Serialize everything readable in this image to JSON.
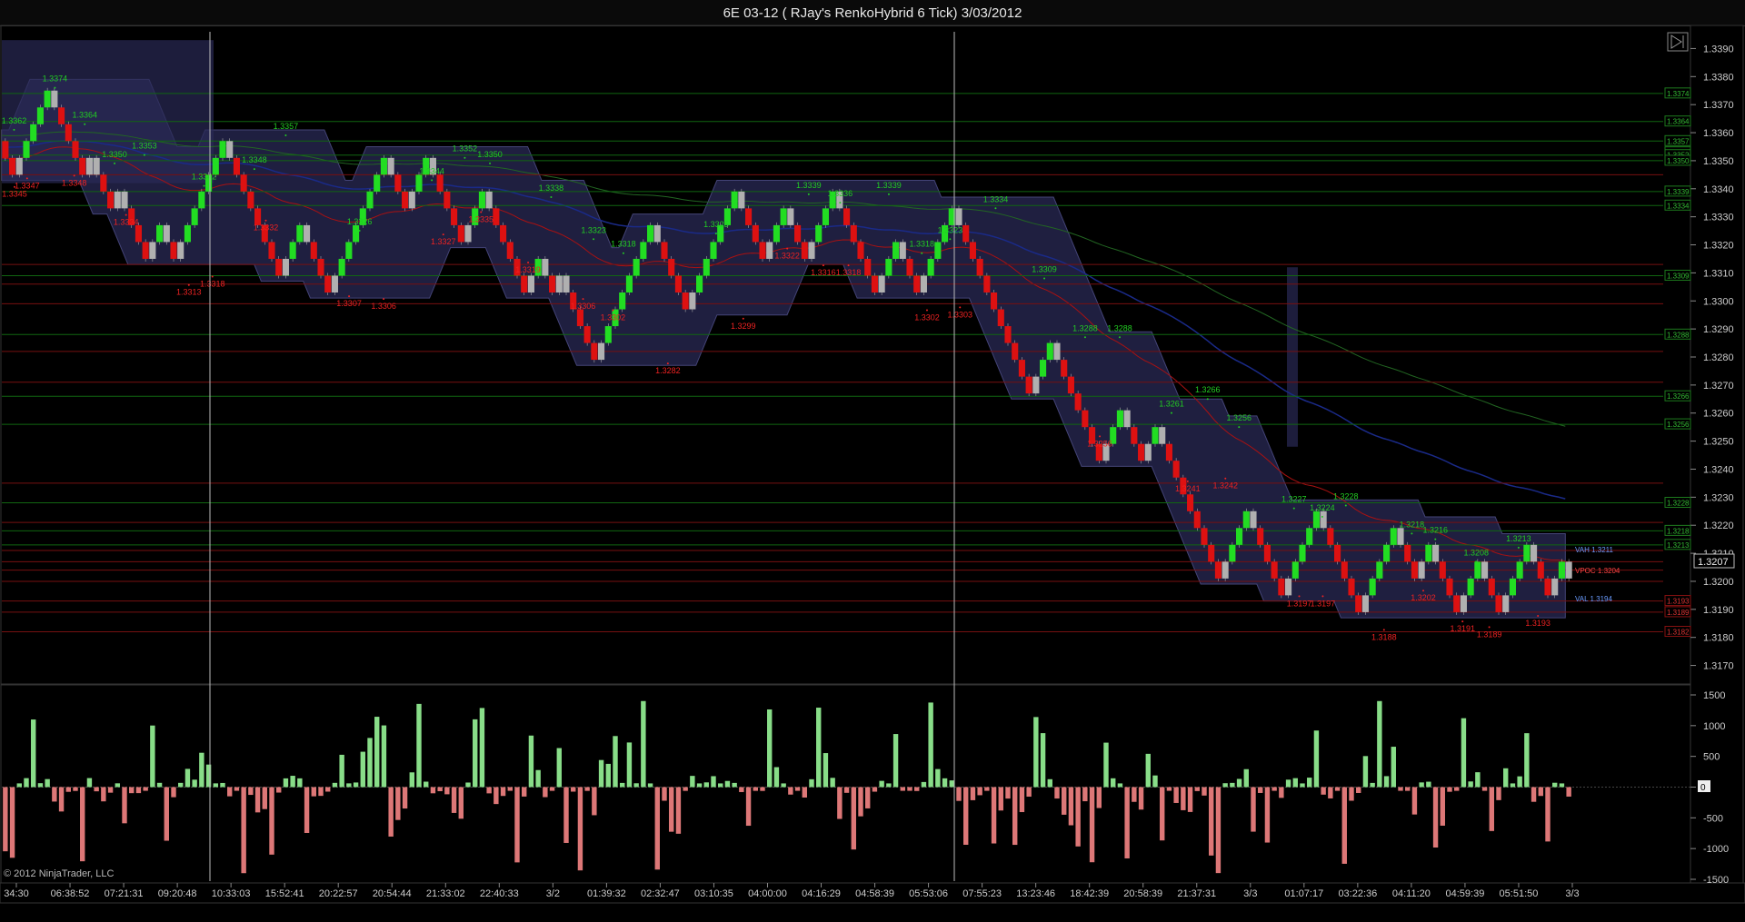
{
  "window": {
    "title": "6E 03-12 ( RJay's RenkoHybrid  6 Tick)  3/03/2012"
  },
  "copyright": "© 2012 NinjaTrader, LLC",
  "last_price": "1.3207",
  "colors": {
    "up_brick": "#22dd22",
    "down_brick": "#dd1111",
    "neutral_brick": "#b0b0b0",
    "band_fill": "#2a2a55",
    "swing_high": "#22cc22",
    "swing_low": "#ee2222",
    "volume_up": "#88dd88",
    "volume_down": "#dd7777",
    "va_label": "#6a9cff"
  },
  "value_area": {
    "vah": "VAH 1.3211",
    "vpoc": "VPOC 1.3204",
    "val": "VAL 1.3194"
  },
  "right_tags_green": [
    "1.3374",
    "1.3364",
    "1.3357",
    "1.3353",
    "1.3352",
    "1.3350",
    "1.3339",
    "1.3334",
    "1.3309",
    "1.3288",
    "1.3266",
    "1.3256",
    "1.3228",
    "1.3218",
    "1.3213"
  ],
  "right_tags_red": [
    "1.3193",
    "1.3189",
    "1.3182"
  ],
  "chart_data": [
    {
      "type": "line",
      "title": "6E 03-12 ( RJay's RenkoHybrid  6 Tick)  3/03/2012",
      "ylim": [
        1.3165,
        1.3395
      ],
      "y_ticks": [
        "1.3390",
        "1.3380",
        "1.3370",
        "1.3360",
        "1.3350",
        "1.3340",
        "1.3330",
        "1.3320",
        "1.3310",
        "1.3300",
        "1.3290",
        "1.3280",
        "1.3270",
        "1.3260",
        "1.3250",
        "1.3240",
        "1.3230",
        "1.3220",
        "1.3210",
        "1.3200",
        "1.3190",
        "1.3180",
        "1.3170"
      ],
      "x_ticks": [
        "34:30",
        "06:38:52",
        "07:21:31",
        "09:20:48",
        "10:33:03",
        "15:52:41",
        "20:22:57",
        "20:54:44",
        "21:33:02",
        "22:40:33",
        "3/2",
        "01:39:32",
        "02:32:47",
        "03:10:35",
        "04:00:00",
        "04:16:29",
        "04:58:39",
        "05:53:06",
        "07:55:23",
        "13:23:46",
        "18:42:39",
        "20:58:39",
        "21:37:31",
        "3/3",
        "01:07:17",
        "03:22:36",
        "04:11:20",
        "04:59:39",
        "05:51:50",
        "3/3"
      ],
      "price_path": [
        1.3357,
        1.3347,
        1.3374,
        1.3348,
        1.3353,
        1.3334,
        1.3341,
        1.3313,
        1.333,
        1.3318,
        1.3348,
        1.3357,
        1.3342,
        1.3307,
        1.3326,
        1.3306,
        1.3344,
        1.3352,
        1.3335,
        1.335,
        1.3319,
        1.3338,
        1.3306,
        1.3318,
        1.3302,
        1.3312,
        1.3282,
        1.3325,
        1.3299,
        1.3322,
        1.3339,
        1.3316,
        1.3336,
        1.3318,
        1.3339,
        1.3302,
        1.3323,
        1.3303,
        1.3334,
        1.3309,
        1.3288,
        1.3266,
        1.3288,
        1.3256,
        1.3241,
        1.3261,
        1.3242,
        1.3256,
        1.32,
        1.3227,
        1.3197,
        1.3228,
        1.3188,
        1.3218,
        1.3202,
        1.3216,
        1.3191,
        1.3208,
        1.3189,
        1.3213,
        1.3193,
        1.321,
        1.3204
      ],
      "swing_high_labels": [
        {
          "text": "1.3362",
          "x": 0.002,
          "price": 1.3362
        },
        {
          "text": "1.3374",
          "x": 0.028,
          "price": 1.3377
        },
        {
          "text": "1.3364",
          "x": 0.047,
          "price": 1.3364
        },
        {
          "text": "1.3350",
          "x": 0.066,
          "price": 1.335
        },
        {
          "text": "1.3353",
          "x": 0.085,
          "price": 1.3353
        },
        {
          "text": "1.3342",
          "x": 0.123,
          "price": 1.3342
        },
        {
          "text": "1.3348",
          "x": 0.155,
          "price": 1.3348
        },
        {
          "text": "1.3357",
          "x": 0.175,
          "price": 1.336
        },
        {
          "text": "1.3344",
          "x": 0.268,
          "price": 1.3344
        },
        {
          "text": "1.3352",
          "x": 0.289,
          "price": 1.3352
        },
        {
          "text": "1.3350",
          "x": 0.305,
          "price": 1.335
        },
        {
          "text": "1.3338",
          "x": 0.344,
          "price": 1.3338
        },
        {
          "text": "1.3326",
          "x": 0.222,
          "price": 1.3326
        },
        {
          "text": "1.3323",
          "x": 0.371,
          "price": 1.3323
        },
        {
          "text": "1.3318",
          "x": 0.39,
          "price": 1.3318
        },
        {
          "text": "1.3325",
          "x": 0.449,
          "price": 1.3325
        },
        {
          "text": "1.3339",
          "x": 0.508,
          "price": 1.3339
        },
        {
          "text": "1.3336",
          "x": 0.528,
          "price": 1.3336
        },
        {
          "text": "1.3339",
          "x": 0.559,
          "price": 1.3339
        },
        {
          "text": "1.3318",
          "x": 0.58,
          "price": 1.3318
        },
        {
          "text": "1.3323",
          "x": 0.598,
          "price": 1.3323
        },
        {
          "text": "1.3334",
          "x": 0.627,
          "price": 1.3334
        },
        {
          "text": "1.3309",
          "x": 0.658,
          "price": 1.3309
        },
        {
          "text": "1.3288",
          "x": 0.684,
          "price": 1.3288
        },
        {
          "text": "1.3288",
          "x": 0.706,
          "price": 1.3288
        },
        {
          "text": "1.3266",
          "x": 0.762,
          "price": 1.3266
        },
        {
          "text": "1.3261",
          "x": 0.739,
          "price": 1.3261
        },
        {
          "text": "1.3256",
          "x": 0.782,
          "price": 1.3256
        },
        {
          "text": "1.3227",
          "x": 0.817,
          "price": 1.3227
        },
        {
          "text": "1.3224",
          "x": 0.835,
          "price": 1.3224
        },
        {
          "text": "1.3228",
          "x": 0.85,
          "price": 1.3228
        },
        {
          "text": "1.3218",
          "x": 0.892,
          "price": 1.3218
        },
        {
          "text": "1.3216",
          "x": 0.907,
          "price": 1.3216
        },
        {
          "text": "1.3208",
          "x": 0.933,
          "price": 1.3208
        },
        {
          "text": "1.3213",
          "x": 0.96,
          "price": 1.3213
        }
      ],
      "swing_low_labels": [
        {
          "text": "1.3345",
          "x": 0.0,
          "price": 1.3341
        },
        {
          "text": "1.3347",
          "x": 0.008,
          "price": 1.3344
        },
        {
          "text": "1.3348",
          "x": 0.038,
          "price": 1.3345
        },
        {
          "text": "1.3334",
          "x": 0.071,
          "price": 1.3331
        },
        {
          "text": "1.3313",
          "x": 0.111,
          "price": 1.3306
        },
        {
          "text": "1.3318",
          "x": 0.126,
          "price": 1.3309
        },
        {
          "text": "1.3332",
          "x": 0.16,
          "price": 1.3329
        },
        {
          "text": "1.3307",
          "x": 0.213,
          "price": 1.3302
        },
        {
          "text": "1.3306",
          "x": 0.235,
          "price": 1.3301
        },
        {
          "text": "1.3327",
          "x": 0.273,
          "price": 1.3324
        },
        {
          "text": "1.3335",
          "x": 0.297,
          "price": 1.3332
        },
        {
          "text": "1.3319",
          "x": 0.327,
          "price": 1.3314
        },
        {
          "text": "1.3306",
          "x": 0.362,
          "price": 1.3301
        },
        {
          "text": "1.3302",
          "x": 0.381,
          "price": 1.3297
        },
        {
          "text": "1.3282",
          "x": 0.416,
          "price": 1.3278
        },
        {
          "text": "1.3299",
          "x": 0.464,
          "price": 1.3294
        },
        {
          "text": "1.3322",
          "x": 0.492,
          "price": 1.3319
        },
        {
          "text": "1.3316",
          "x": 0.515,
          "price": 1.3313
        },
        {
          "text": "1.3318",
          "x": 0.531,
          "price": 1.3313
        },
        {
          "text": "1.3302",
          "x": 0.581,
          "price": 1.3297
        },
        {
          "text": "1.3303",
          "x": 0.602,
          "price": 1.3298
        },
        {
          "text": "1.3256",
          "x": 0.691,
          "price": 1.3252
        },
        {
          "text": "1.3241",
          "x": 0.747,
          "price": 1.3236
        },
        {
          "text": "1.3242",
          "x": 0.771,
          "price": 1.3237
        },
        {
          "text": "1.3197",
          "x": 0.818,
          "price": 1.3195
        },
        {
          "text": "1.3197",
          "x": 0.833,
          "price": 1.3195
        },
        {
          "text": "1.3188",
          "x": 0.872,
          "price": 1.3183
        },
        {
          "text": "1.3202",
          "x": 0.897,
          "price": 1.3197
        },
        {
          "text": "1.3191",
          "x": 0.922,
          "price": 1.3186
        },
        {
          "text": "1.3189",
          "x": 0.939,
          "price": 1.3184
        },
        {
          "text": "1.3193",
          "x": 0.97,
          "price": 1.3188
        }
      ],
      "horizontal_levels_green": [
        1.3374,
        1.3364,
        1.3357,
        1.3352,
        1.335,
        1.3339,
        1.3334,
        1.3309,
        1.3288,
        1.3266,
        1.3256,
        1.3228,
        1.3218,
        1.3213
      ],
      "horizontal_levels_red": [
        1.3345,
        1.3313,
        1.3306,
        1.3299,
        1.3282,
        1.3271,
        1.3235,
        1.3221,
        1.3211,
        1.3207,
        1.3204,
        1.32,
        1.3193,
        1.3189,
        1.3182
      ],
      "grid": true
    },
    {
      "type": "bar",
      "title": "",
      "ylim": [
        -1500,
        1500
      ],
      "y_ticks": [
        "1500",
        "1000",
        "500",
        "0",
        "-500",
        "-1000",
        "-1500"
      ],
      "seed": 17
    }
  ]
}
